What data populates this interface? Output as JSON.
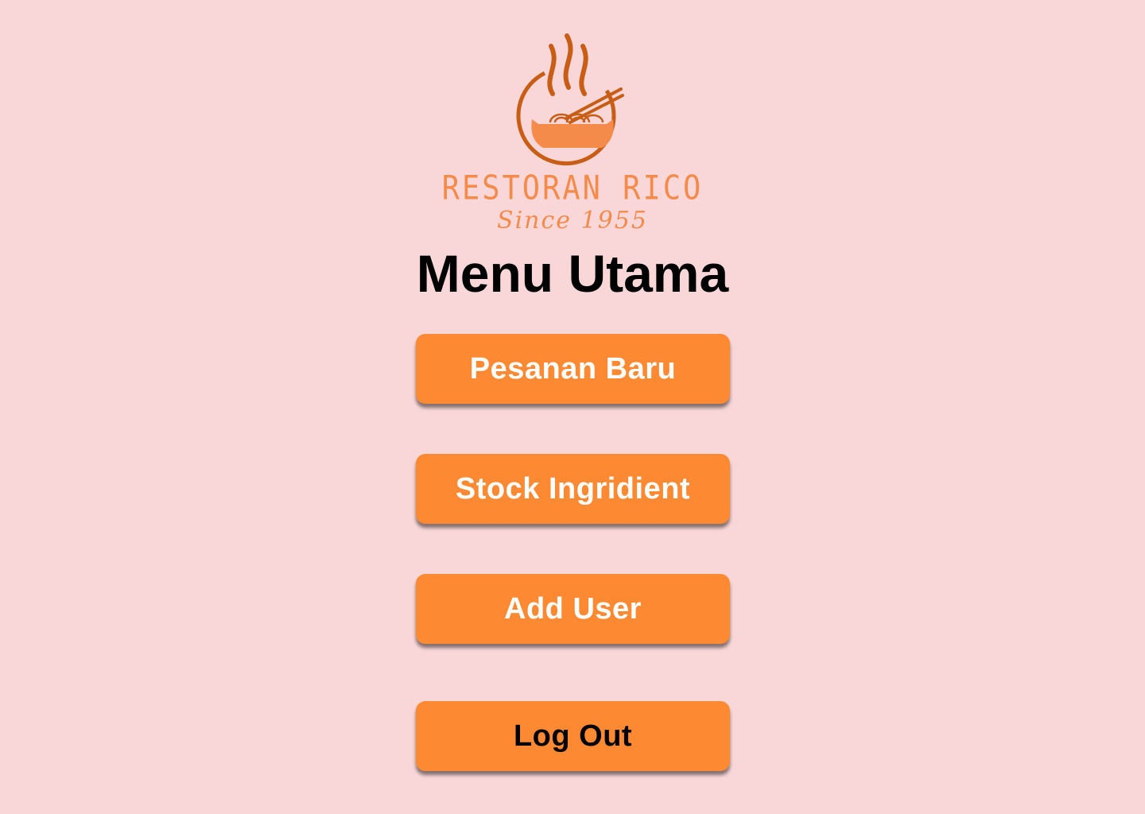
{
  "brand": {
    "name": "RESTORAN RICO",
    "tagline": "Since 1955",
    "logo_icon": "noodle-bowl-icon",
    "color": "#f58b4a",
    "icon_color": "#c85e16"
  },
  "page": {
    "title": "Menu Utama",
    "background": "#f9d6d7"
  },
  "menu": {
    "button_color": "#fd8a33",
    "buttons": [
      {
        "label": "Pesanan Baru",
        "text_color": "#ffffff"
      },
      {
        "label": "Stock Ingridient",
        "text_color": "#ffffff"
      },
      {
        "label": "Add User",
        "text_color": "#ffffff"
      },
      {
        "label": "Log Out",
        "text_color": "#000000"
      }
    ]
  }
}
